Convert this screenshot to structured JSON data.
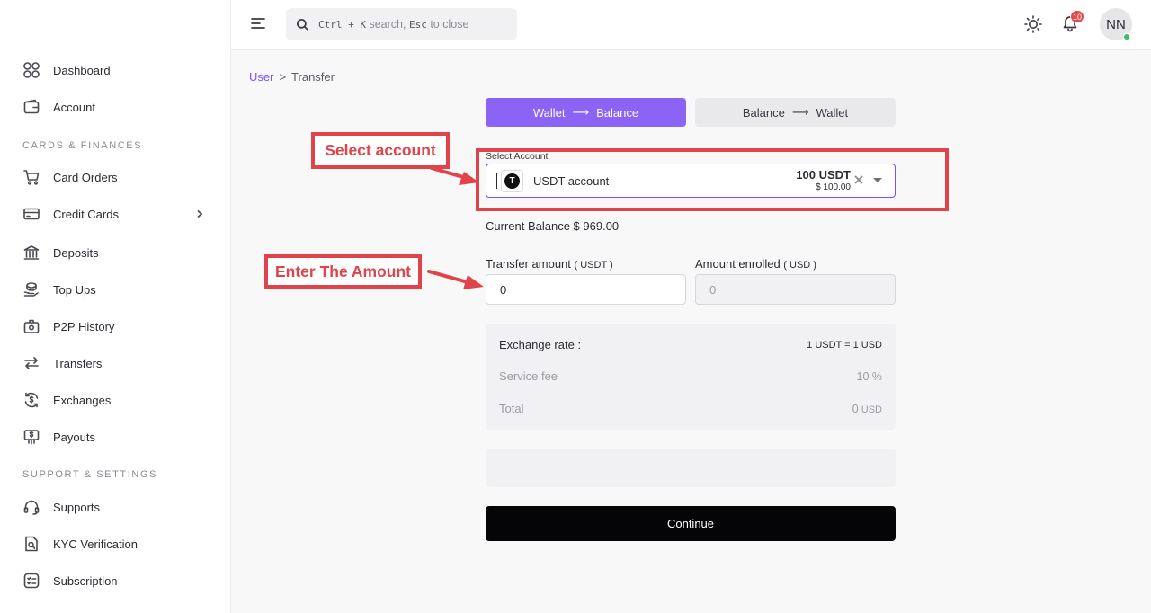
{
  "sidebar": {
    "items": [
      {
        "label": "Dashboard",
        "icon": "grid-icon"
      },
      {
        "label": "Account",
        "icon": "wallet-icon"
      },
      {
        "label": "Card Orders",
        "icon": "cart-icon"
      },
      {
        "label": "Credit Cards",
        "icon": "credit-card-icon"
      },
      {
        "label": "Deposits",
        "icon": "bank-icon"
      },
      {
        "label": "Top Ups",
        "icon": "coins-icon"
      },
      {
        "label": "P2P History",
        "icon": "p2p-icon"
      },
      {
        "label": "Transfers",
        "icon": "transfer-arrows-icon"
      },
      {
        "label": "Exchanges",
        "icon": "exchange-icon"
      },
      {
        "label": "Payouts",
        "icon": "payout-icon"
      },
      {
        "label": "Supports",
        "icon": "headset-icon"
      },
      {
        "label": "KYC Verification",
        "icon": "id-check-icon"
      },
      {
        "label": "Subscription",
        "icon": "subscription-icon"
      }
    ],
    "sections": {
      "cards_finances": "CARDS & FINANCES",
      "support_settings": "SUPPORT & SETTINGS"
    }
  },
  "topbar": {
    "search_key": "Ctrl + K",
    "search_text1": "search,",
    "search_esc": "Esc",
    "search_text2": "to close",
    "notifications_count": "10",
    "avatar_initials": "NN"
  },
  "breadcrumb": {
    "link": "User",
    "separator": ">",
    "current": "Transfer"
  },
  "tabs": {
    "active": {
      "from": "Wallet",
      "arrow": "⟶",
      "to": "Balance"
    },
    "inactive": {
      "from": "Balance",
      "arrow": "⟶",
      "to": "Wallet"
    }
  },
  "select_account": {
    "label": "Select Account",
    "token_letter": "T",
    "account_name": "USDT account",
    "amount": "100 USDT",
    "usd_value": "$ 100.00"
  },
  "current_balance": "Current Balance $ 969.00",
  "transfer": {
    "amount_label": "Transfer amount",
    "amount_unit": "( USDT )",
    "amount_value": "0",
    "enrolled_label": "Amount enrolled",
    "enrolled_unit": "( USD )",
    "enrolled_placeholder": "0"
  },
  "summary": {
    "exchange_label": "Exchange rate :",
    "exchange_value": "1 USDT = 1 USD",
    "fee_label": "Service fee",
    "fee_value": "10 %",
    "total_label": "Total",
    "total_value": "0",
    "total_unit": "USD"
  },
  "continue_label": "Continue",
  "annotations": {
    "select_account": "Select account",
    "enter_amount": "Enter The Amount",
    "color": "#e0434a"
  },
  "colors": {
    "accent": "#8b63f5",
    "link": "#7c4dff",
    "primary_button": "#050507",
    "online": "#37c06a",
    "badge": "#e5484d"
  }
}
